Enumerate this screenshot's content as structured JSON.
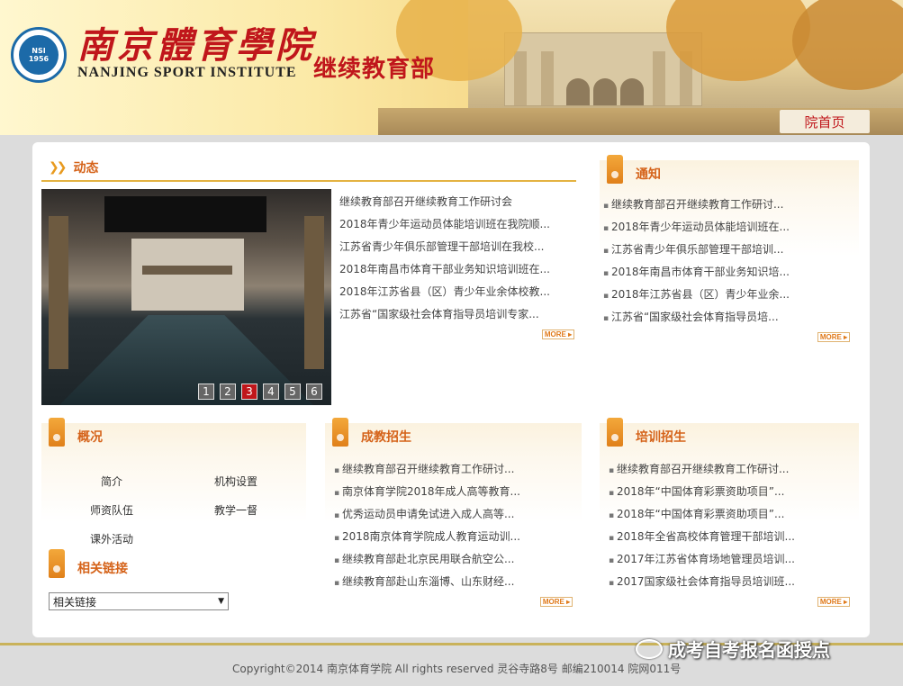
{
  "header": {
    "logo_seal_text_top": "NSI",
    "logo_seal_text_year": "1956",
    "school_name_cn": "南京體育學院",
    "school_name_en": "NANJING SPORT INSTITUTE",
    "department": "继续教育部",
    "home_link": "院首页"
  },
  "dynamics": {
    "title": "动态",
    "pager": [
      "1",
      "2",
      "3",
      "4",
      "5",
      "6"
    ],
    "active_page": "3",
    "items": [
      "继续教育部召开继续教育工作研讨会",
      "2018年青少年运动员体能培训班在我院顺...",
      "江苏省青少年俱乐部管理干部培训在我校...",
      "2018年南昌市体育干部业务知识培训班在...",
      "2018年江苏省县（区）青少年业余体校教...",
      "江苏省“国家级社会体育指导员培训专家..."
    ],
    "more": "MORE ▸"
  },
  "notice": {
    "title": "通知",
    "items": [
      "继续教育部召开继续教育工作研讨...",
      "2018年青少年运动员体能培训班在...",
      "江苏省青少年俱乐部管理干部培训...",
      "2018年南昌市体育干部业务知识培...",
      "2018年江苏省县（区）青少年业余...",
      "江苏省“国家级社会体育指导员培..."
    ],
    "more": "MORE ▸"
  },
  "overview": {
    "title": "概况",
    "links": [
      "简介",
      "机构设置",
      "师资队伍",
      "教学一督",
      "课外活动"
    ]
  },
  "related": {
    "title": "相关链接",
    "select_value": "相关链接"
  },
  "adult_enroll": {
    "title": "成教招生",
    "items": [
      "继续教育部召开继续教育工作研讨...",
      "南京体育学院2018年成人高等教育...",
      "优秀运动员申请免试进入成人高等...",
      "2018南京体育学院成人教育运动训...",
      "继续教育部赴北京民用联合航空公...",
      "继续教育部赴山东淄博、山东财经..."
    ],
    "more": "MORE ▸"
  },
  "training_enroll": {
    "title": "培训招生",
    "items": [
      "继续教育部召开继续教育工作研讨...",
      "2018年“中国体育彩票资助项目”...",
      "2018年“中国体育彩票资助项目”...",
      "2018年全省高校体育管理干部培训...",
      "2017年江苏省体育场地管理员培训...",
      "2017国家级社会体育指导员培训班..."
    ],
    "more": "MORE ▸"
  },
  "footer": {
    "copyright": "Copyright©2014 南京体育学院 All rights reserved 灵谷寺路8号 邮编210014 院网011号"
  },
  "watermark": {
    "text": "成考自考报名函授点"
  }
}
